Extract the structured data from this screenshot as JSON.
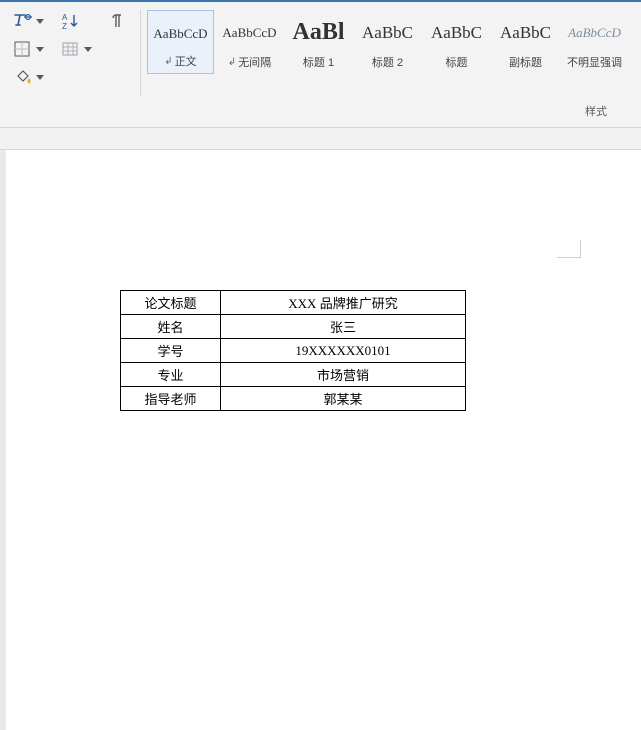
{
  "styles": {
    "group_label": "样式",
    "items": [
      {
        "preview": "AaBbCcD",
        "label": "正文",
        "size": "13px",
        "pmark": true,
        "selected": true,
        "italic": false,
        "bold": false
      },
      {
        "preview": "AaBbCcD",
        "label": "无间隔",
        "size": "13px",
        "pmark": true,
        "selected": false,
        "italic": false,
        "bold": false
      },
      {
        "preview": "AaBl",
        "label": "标题 1",
        "size": "24px",
        "pmark": false,
        "selected": false,
        "italic": false,
        "bold": true
      },
      {
        "preview": "AaBbC",
        "label": "标题 2",
        "size": "17px",
        "pmark": false,
        "selected": false,
        "italic": false,
        "bold": false
      },
      {
        "preview": "AaBbC",
        "label": "标题",
        "size": "17px",
        "pmark": false,
        "selected": false,
        "italic": false,
        "bold": false
      },
      {
        "preview": "AaBbC",
        "label": "副标题",
        "size": "17px",
        "pmark": false,
        "selected": false,
        "italic": false,
        "bold": false
      },
      {
        "preview": "AaBbCcD",
        "label": "不明显强调",
        "size": "13px",
        "pmark": false,
        "selected": false,
        "italic": true,
        "bold": false
      }
    ]
  },
  "table": {
    "rows": [
      {
        "h": "论文标题",
        "v": "XXX 品牌推广研究"
      },
      {
        "h": "姓名",
        "v": "张三"
      },
      {
        "h": "学号",
        "v": "19XXXXXX0101"
      },
      {
        "h": "专业",
        "v": "市场营销"
      },
      {
        "h": "指导老师",
        "v": "郭某某"
      }
    ]
  }
}
